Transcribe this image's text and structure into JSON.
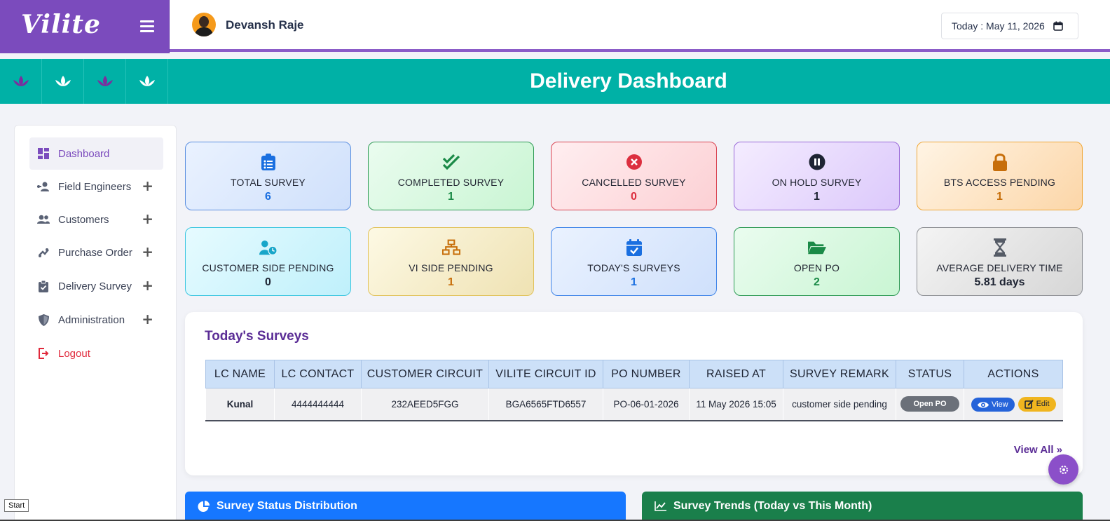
{
  "app": {
    "logo": "Vilite"
  },
  "header": {
    "user_name": "Devansh Raje",
    "date_text": "Today : May 11, 2026"
  },
  "banner": {
    "title": "Delivery Dashboard"
  },
  "sidebar": {
    "items": [
      {
        "label": "Dashboard",
        "icon": "dashboard-icon",
        "active": true
      },
      {
        "label": "Field Engineers",
        "icon": "field-engineers-icon"
      },
      {
        "label": "Customers",
        "icon": "customers-icon"
      },
      {
        "label": "Purchase Order",
        "icon": "purchase-order-icon"
      },
      {
        "label": "Delivery Survey",
        "icon": "clipboard-check-icon"
      },
      {
        "label": "Administration",
        "icon": "shield-icon"
      },
      {
        "label": "Logout",
        "icon": "logout-icon"
      }
    ]
  },
  "cards": [
    {
      "title": "TOTAL SURVEY",
      "value": "6",
      "icon": "clipboard-list-icon"
    },
    {
      "title": "COMPLETED SURVEY",
      "value": "1",
      "icon": "double-check-icon"
    },
    {
      "title": "CANCELLED SURVEY",
      "value": "0",
      "icon": "x-circle-icon"
    },
    {
      "title": "ON HOLD SURVEY",
      "value": "1",
      "icon": "pause-circle-icon"
    },
    {
      "title": "BTS ACCESS PENDING",
      "value": "1",
      "icon": "lock-icon"
    },
    {
      "title": "CUSTOMER SIDE PENDING",
      "value": "0",
      "icon": "user-clock-icon"
    },
    {
      "title": "VI SIDE PENDING",
      "value": "1",
      "icon": "network-icon"
    },
    {
      "title": "TODAY'S SURVEYS",
      "value": "1",
      "icon": "calendar-check-icon"
    },
    {
      "title": "OPEN PO",
      "value": "2",
      "icon": "folder-open-icon"
    },
    {
      "title": "AVERAGE DELIVERY TIME",
      "value": "5.81 days",
      "icon": "hourglass-icon"
    }
  ],
  "today_surveys": {
    "title": "Today's Surveys",
    "columns": [
      "LC NAME",
      "LC CONTACT",
      "CUSTOMER CIRCUIT",
      "VILITE CIRCUIT ID",
      "PO NUMBER",
      "RAISED AT",
      "SURVEY REMARK",
      "STATUS",
      "ACTIONS"
    ],
    "rows": [
      {
        "lc_name": "Kunal",
        "lc_contact": "4444444444",
        "customer_circuit": "232AEED5FGG",
        "vilite_circuit_id": "BGA6565FTD6557",
        "po_number": "PO-06-01-2026",
        "raised_at": "11 May 2026 15:05",
        "survey_remark": "customer side pending",
        "status": "Open PO",
        "view_label": "View",
        "edit_label": "Edit"
      }
    ],
    "view_all": "View All »"
  },
  "charts": {
    "status_distribution_title": "Survey Status Distribution",
    "trends_title": "Survey Trends (Today vs This Month)"
  },
  "taskbar": {
    "start_label": "Start"
  },
  "colors": {
    "brand_purple": "#7b4bbd",
    "teal": "#00b1a6",
    "blue": "#1677ff",
    "green": "#1a7f4b"
  }
}
